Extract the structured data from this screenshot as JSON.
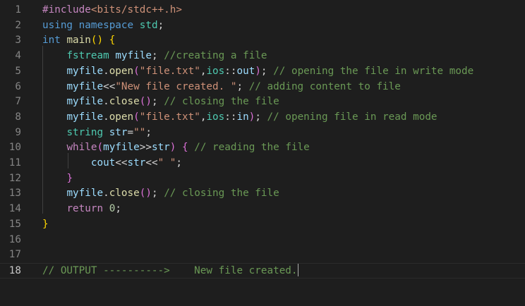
{
  "editor": {
    "gutter": [
      "1",
      "2",
      "3",
      "4",
      "5",
      "6",
      "7",
      "8",
      "9",
      "10",
      "11",
      "12",
      "13",
      "14",
      "15",
      "16",
      "17",
      "18"
    ],
    "lines": [
      {
        "tokens": [
          {
            "t": "#include",
            "c": "pre"
          },
          {
            "t": "<bits/stdc++.h>",
            "c": "str"
          }
        ]
      },
      {
        "tokens": [
          {
            "t": "using",
            "c": "kw"
          },
          {
            "t": " ",
            "c": "pun"
          },
          {
            "t": "namespace",
            "c": "kw"
          },
          {
            "t": " ",
            "c": "pun"
          },
          {
            "t": "std",
            "c": "type"
          },
          {
            "t": ";",
            "c": "pun"
          }
        ]
      },
      {
        "tokens": [
          {
            "t": "int",
            "c": "kw"
          },
          {
            "t": " ",
            "c": "pun"
          },
          {
            "t": "main",
            "c": "fn"
          },
          {
            "t": "()",
            "c": "br1"
          },
          {
            "t": " ",
            "c": "pun"
          },
          {
            "t": "{",
            "c": "br1"
          }
        ]
      },
      {
        "tokens": [
          {
            "t": "    ",
            "c": "pun"
          },
          {
            "t": "fstream",
            "c": "type"
          },
          {
            "t": " ",
            "c": "pun"
          },
          {
            "t": "myfile",
            "c": "var"
          },
          {
            "t": "; ",
            "c": "pun"
          },
          {
            "t": "//creating a file",
            "c": "com"
          }
        ]
      },
      {
        "tokens": [
          {
            "t": "    ",
            "c": "pun"
          },
          {
            "t": "myfile",
            "c": "var"
          },
          {
            "t": ".",
            "c": "pun"
          },
          {
            "t": "open",
            "c": "fn"
          },
          {
            "t": "(",
            "c": "br2"
          },
          {
            "t": "\"file.txt\"",
            "c": "str"
          },
          {
            "t": ",",
            "c": "pun"
          },
          {
            "t": "ios",
            "c": "type"
          },
          {
            "t": "::",
            "c": "pun"
          },
          {
            "t": "out",
            "c": "var"
          },
          {
            "t": ")",
            "c": "br2"
          },
          {
            "t": "; ",
            "c": "pun"
          },
          {
            "t": "// opening the file in write mode",
            "c": "com"
          }
        ]
      },
      {
        "tokens": [
          {
            "t": "    ",
            "c": "pun"
          },
          {
            "t": "myfile",
            "c": "var"
          },
          {
            "t": "<<",
            "c": "pun"
          },
          {
            "t": "\"New file created. \"",
            "c": "str"
          },
          {
            "t": "; ",
            "c": "pun"
          },
          {
            "t": "// adding content to file",
            "c": "com"
          }
        ]
      },
      {
        "tokens": [
          {
            "t": "    ",
            "c": "pun"
          },
          {
            "t": "myfile",
            "c": "var"
          },
          {
            "t": ".",
            "c": "pun"
          },
          {
            "t": "close",
            "c": "fn"
          },
          {
            "t": "()",
            "c": "br2"
          },
          {
            "t": "; ",
            "c": "pun"
          },
          {
            "t": "// closing the file",
            "c": "com"
          }
        ]
      },
      {
        "tokens": [
          {
            "t": "    ",
            "c": "pun"
          },
          {
            "t": "myfile",
            "c": "var"
          },
          {
            "t": ".",
            "c": "pun"
          },
          {
            "t": "open",
            "c": "fn"
          },
          {
            "t": "(",
            "c": "br2"
          },
          {
            "t": "\"file.txt\"",
            "c": "str"
          },
          {
            "t": ",",
            "c": "pun"
          },
          {
            "t": "ios",
            "c": "type"
          },
          {
            "t": "::",
            "c": "pun"
          },
          {
            "t": "in",
            "c": "var"
          },
          {
            "t": ")",
            "c": "br2"
          },
          {
            "t": "; ",
            "c": "pun"
          },
          {
            "t": "// opening file in read mode",
            "c": "com"
          }
        ]
      },
      {
        "tokens": [
          {
            "t": "    ",
            "c": "pun"
          },
          {
            "t": "string",
            "c": "type"
          },
          {
            "t": " ",
            "c": "pun"
          },
          {
            "t": "str",
            "c": "var"
          },
          {
            "t": "=",
            "c": "pun"
          },
          {
            "t": "\"\"",
            "c": "str"
          },
          {
            "t": ";",
            "c": "pun"
          }
        ]
      },
      {
        "tokens": [
          {
            "t": "    ",
            "c": "pun"
          },
          {
            "t": "while",
            "c": "ctrl"
          },
          {
            "t": "(",
            "c": "br2"
          },
          {
            "t": "myfile",
            "c": "var"
          },
          {
            "t": ">>",
            "c": "pun"
          },
          {
            "t": "str",
            "c": "var"
          },
          {
            "t": ")",
            "c": "br2"
          },
          {
            "t": " ",
            "c": "pun"
          },
          {
            "t": "{",
            "c": "br2"
          },
          {
            "t": " ",
            "c": "pun"
          },
          {
            "t": "// reading the file",
            "c": "com"
          }
        ]
      },
      {
        "tokens": [
          {
            "t": "        ",
            "c": "pun"
          },
          {
            "t": "cout",
            "c": "var"
          },
          {
            "t": "<<",
            "c": "pun"
          },
          {
            "t": "str",
            "c": "var"
          },
          {
            "t": "<<",
            "c": "pun"
          },
          {
            "t": "\" \"",
            "c": "str"
          },
          {
            "t": ";",
            "c": "pun"
          }
        ]
      },
      {
        "tokens": [
          {
            "t": "    ",
            "c": "pun"
          },
          {
            "t": "}",
            "c": "br2"
          }
        ]
      },
      {
        "tokens": [
          {
            "t": "    ",
            "c": "pun"
          },
          {
            "t": "myfile",
            "c": "var"
          },
          {
            "t": ".",
            "c": "pun"
          },
          {
            "t": "close",
            "c": "fn"
          },
          {
            "t": "()",
            "c": "br2"
          },
          {
            "t": "; ",
            "c": "pun"
          },
          {
            "t": "// closing the file",
            "c": "com"
          }
        ]
      },
      {
        "tokens": [
          {
            "t": "    ",
            "c": "pun"
          },
          {
            "t": "return",
            "c": "ctrl"
          },
          {
            "t": " ",
            "c": "pun"
          },
          {
            "t": "0",
            "c": "num"
          },
          {
            "t": ";",
            "c": "pun"
          }
        ]
      },
      {
        "tokens": [
          {
            "t": "}",
            "c": "br1"
          }
        ]
      },
      {
        "tokens": []
      },
      {
        "tokens": []
      },
      {
        "tokens": [
          {
            "t": "// OUTPUT ---------->    New file created.",
            "c": "com"
          }
        ],
        "active": true,
        "cursor": true
      }
    ]
  },
  "colors": {
    "background": "#1e1e1e",
    "comment": "#6a9955",
    "keyword": "#569cd6",
    "string": "#ce9178",
    "function": "#dcdcaa",
    "type": "#4ec9b0",
    "variable": "#9cdcfe"
  }
}
